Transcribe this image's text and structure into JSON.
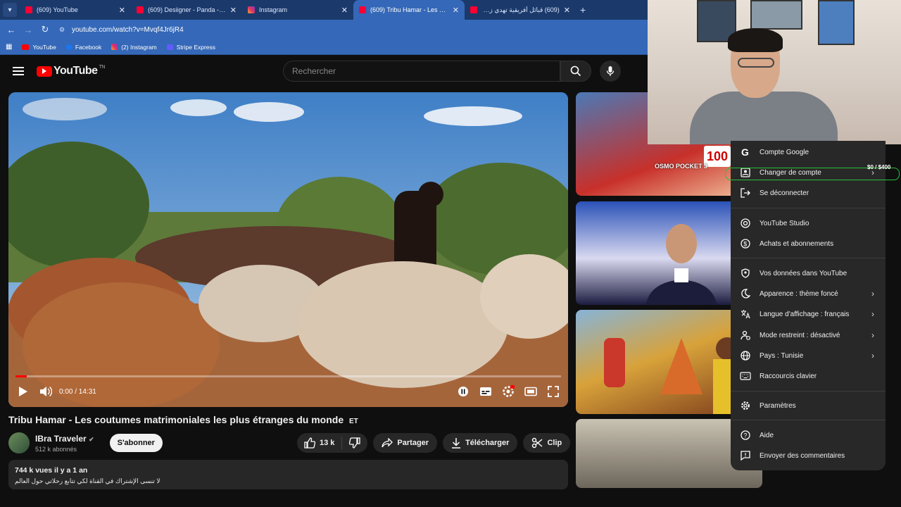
{
  "browser": {
    "tabs": [
      {
        "label": "(609) YouTube",
        "icon": "youtube",
        "active": false
      },
      {
        "label": "(609) Desiigner - Panda - YouTube",
        "icon": "youtube",
        "active": false
      },
      {
        "label": "Instagram",
        "icon": "instagram",
        "active": false
      },
      {
        "label": "(609) Tribu Hamar - Les coutumes",
        "icon": "youtube",
        "active": true
      },
      {
        "label": "(609) قبائل أفريقية تهدي زوجاتها",
        "icon": "youtube",
        "active": false
      }
    ],
    "url": "youtube.com/watch?v=Mvqf4Jr6jR4",
    "bookmarks": [
      "YouTube",
      "Facebook",
      "(2) Instagram",
      "Stripe Express"
    ]
  },
  "youtube": {
    "logo_text": "YouTube",
    "logo_region": "TN",
    "search_placeholder": "Rechercher"
  },
  "player": {
    "time": "0:00 / 14:31",
    "progress_fraction": 0.0
  },
  "video": {
    "title": "Tribu Hamar - Les coutumes matrimoniales les plus étranges du monde",
    "title_suffix": "ET",
    "channel_name": "IBra Traveler",
    "subscribers": "512 k abonnés",
    "subscribe_label": "S'abonner",
    "likes": "13 k",
    "share_label": "Partager",
    "download_label": "Télécharger",
    "clip_label": "Clip",
    "description_stats": "744 k vues  il y a 1 an",
    "description_text": "لا تنسى الإشتراك في القناة لكي تتابع رحلاتي حول العالم"
  },
  "thumbnails": {
    "t1_caption": "OSMO POCKET 3",
    "t1_number": "100"
  },
  "overlay": {
    "budget": "$0  / $400"
  },
  "account_menu": {
    "items": [
      {
        "label": "Compte Google",
        "icon": "google-icon",
        "arrow": false
      },
      {
        "label": "Changer de compte",
        "icon": "switch-account-icon",
        "arrow": true
      },
      {
        "label": "Se déconnecter",
        "icon": "sign-out-icon",
        "arrow": false
      },
      {
        "label": "YouTube Studio",
        "icon": "studio-icon",
        "arrow": false
      },
      {
        "label": "Achats et abonnements",
        "icon": "dollar-icon",
        "arrow": false
      },
      {
        "label": "Vos données dans YouTube",
        "icon": "shield-icon",
        "arrow": false
      },
      {
        "label": "Apparence : thème foncé",
        "icon": "moon-icon",
        "arrow": true
      },
      {
        "label": "Langue d'affichage : français",
        "icon": "translate-icon",
        "arrow": true
      },
      {
        "label": "Mode restreint : désactivé",
        "icon": "restricted-icon",
        "arrow": true
      },
      {
        "label": "Pays : Tunisie",
        "icon": "globe-icon",
        "arrow": true
      },
      {
        "label": "Raccourcis clavier",
        "icon": "keyboard-icon",
        "arrow": false
      },
      {
        "label": "Paramètres",
        "icon": "gear-icon",
        "arrow": false
      },
      {
        "label": "Aide",
        "icon": "help-icon",
        "arrow": false
      },
      {
        "label": "Envoyer des commentaires",
        "icon": "feedback-icon",
        "arrow": false
      }
    ]
  }
}
